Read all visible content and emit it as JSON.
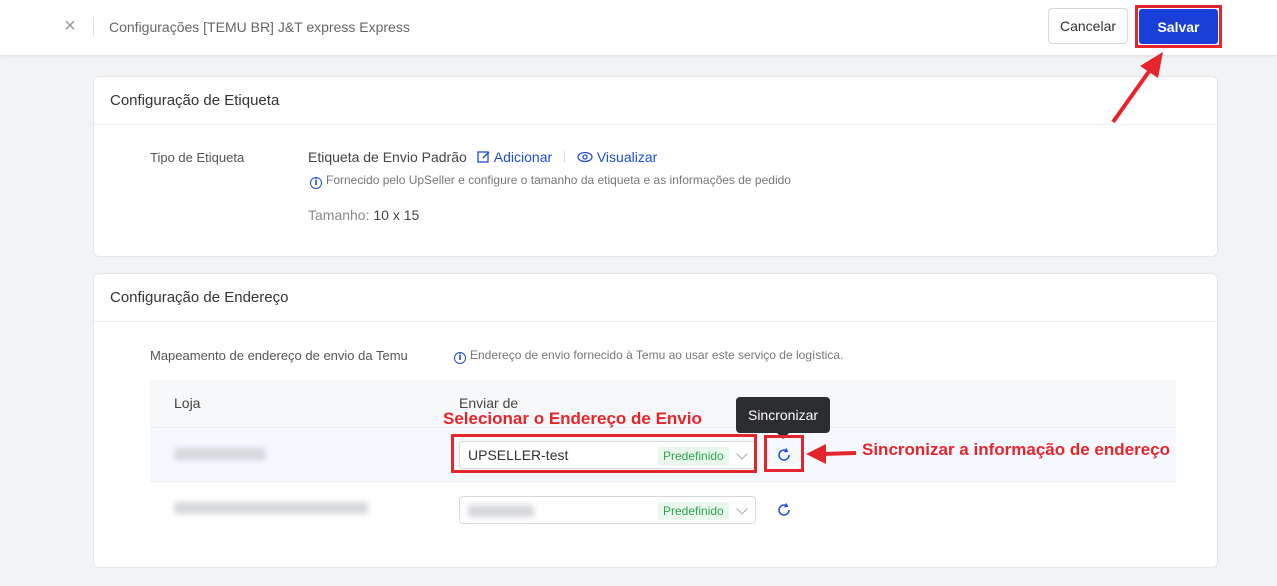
{
  "header": {
    "close_icon": "close-icon",
    "title": "Configurações [TEMU BR] J&T express Express",
    "cancel_label": "Cancelar",
    "save_label": "Salvar"
  },
  "label_section": {
    "title": "Configuração de Etiqueta",
    "type_label": "Tipo de Etiqueta",
    "type_value": "Etiqueta de Envio Padrão",
    "add_label": "Adicionar",
    "view_label": "Visualizar",
    "info_text": "Fornecido pelo UpSeller e configure o tamanho da etiqueta e as informações de pedido",
    "size_label": "Tamanho:",
    "size_value": "10 x 15"
  },
  "address_section": {
    "title": "Configuração de Endereço",
    "mapping_label": "Mapeamento de endereço de envio da Temu",
    "mapping_info": "Endereço de envio fornecido à Temu ao usar este serviço de logística.",
    "columns": [
      "Loja",
      "Enviar de"
    ],
    "rows": [
      {
        "store": "",
        "address": "UPSELLER-test",
        "badge": "Predefinido"
      },
      {
        "store": "",
        "address": "",
        "badge": "Predefinido"
      }
    ],
    "sync_tooltip": "Sincronizar"
  },
  "annotations": {
    "select_address": "Selecionar o Endereço de Envio",
    "sync_info": "Sincronizar a informação de endereço",
    "color": "#e5252c"
  },
  "colors": {
    "primary": "#1a3fd8",
    "link": "#1d4ed8",
    "success_badge": "#2ea44f"
  }
}
